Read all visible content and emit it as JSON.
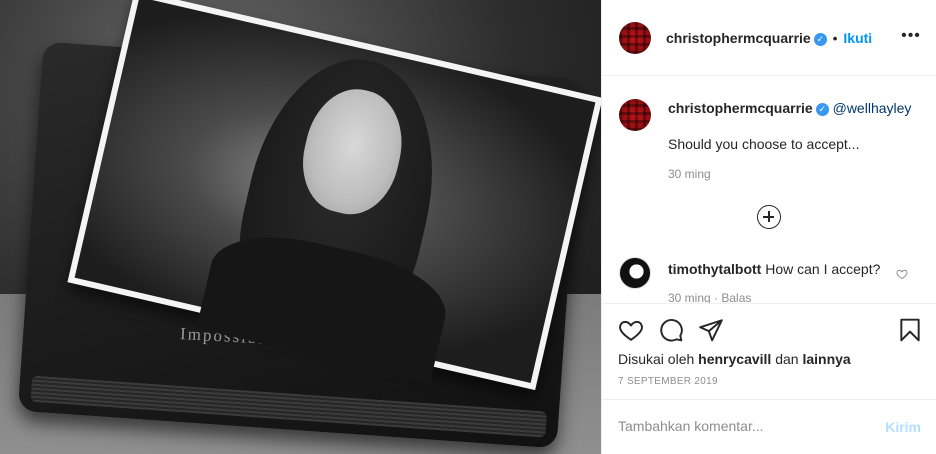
{
  "post": {
    "author": "christophermcquarrie",
    "follow_label": "Ikuti",
    "more_label": "•••",
    "photo_book_title": "Impossible Mission Force"
  },
  "caption": {
    "author": "christophermcquarrie",
    "mention": "@wellhayley",
    "text": "Should you choose to accept...",
    "time": "30 ming"
  },
  "comment": {
    "author": "timothytalbott",
    "text": "How can I accept?",
    "meta": "30 ming · Balas"
  },
  "likes": {
    "prefix": "Disukai oleh",
    "user": "henrycavill",
    "conj": "dan",
    "suffix": "lainnya"
  },
  "date": "7 SEPTEMBER 2019",
  "add_comment": {
    "placeholder": "Tambahkan komentar...",
    "post_label": "Kirim"
  },
  "colors": {
    "accent": "#0095f6",
    "verified": "#3897f0",
    "muted": "#8e8e8e"
  }
}
